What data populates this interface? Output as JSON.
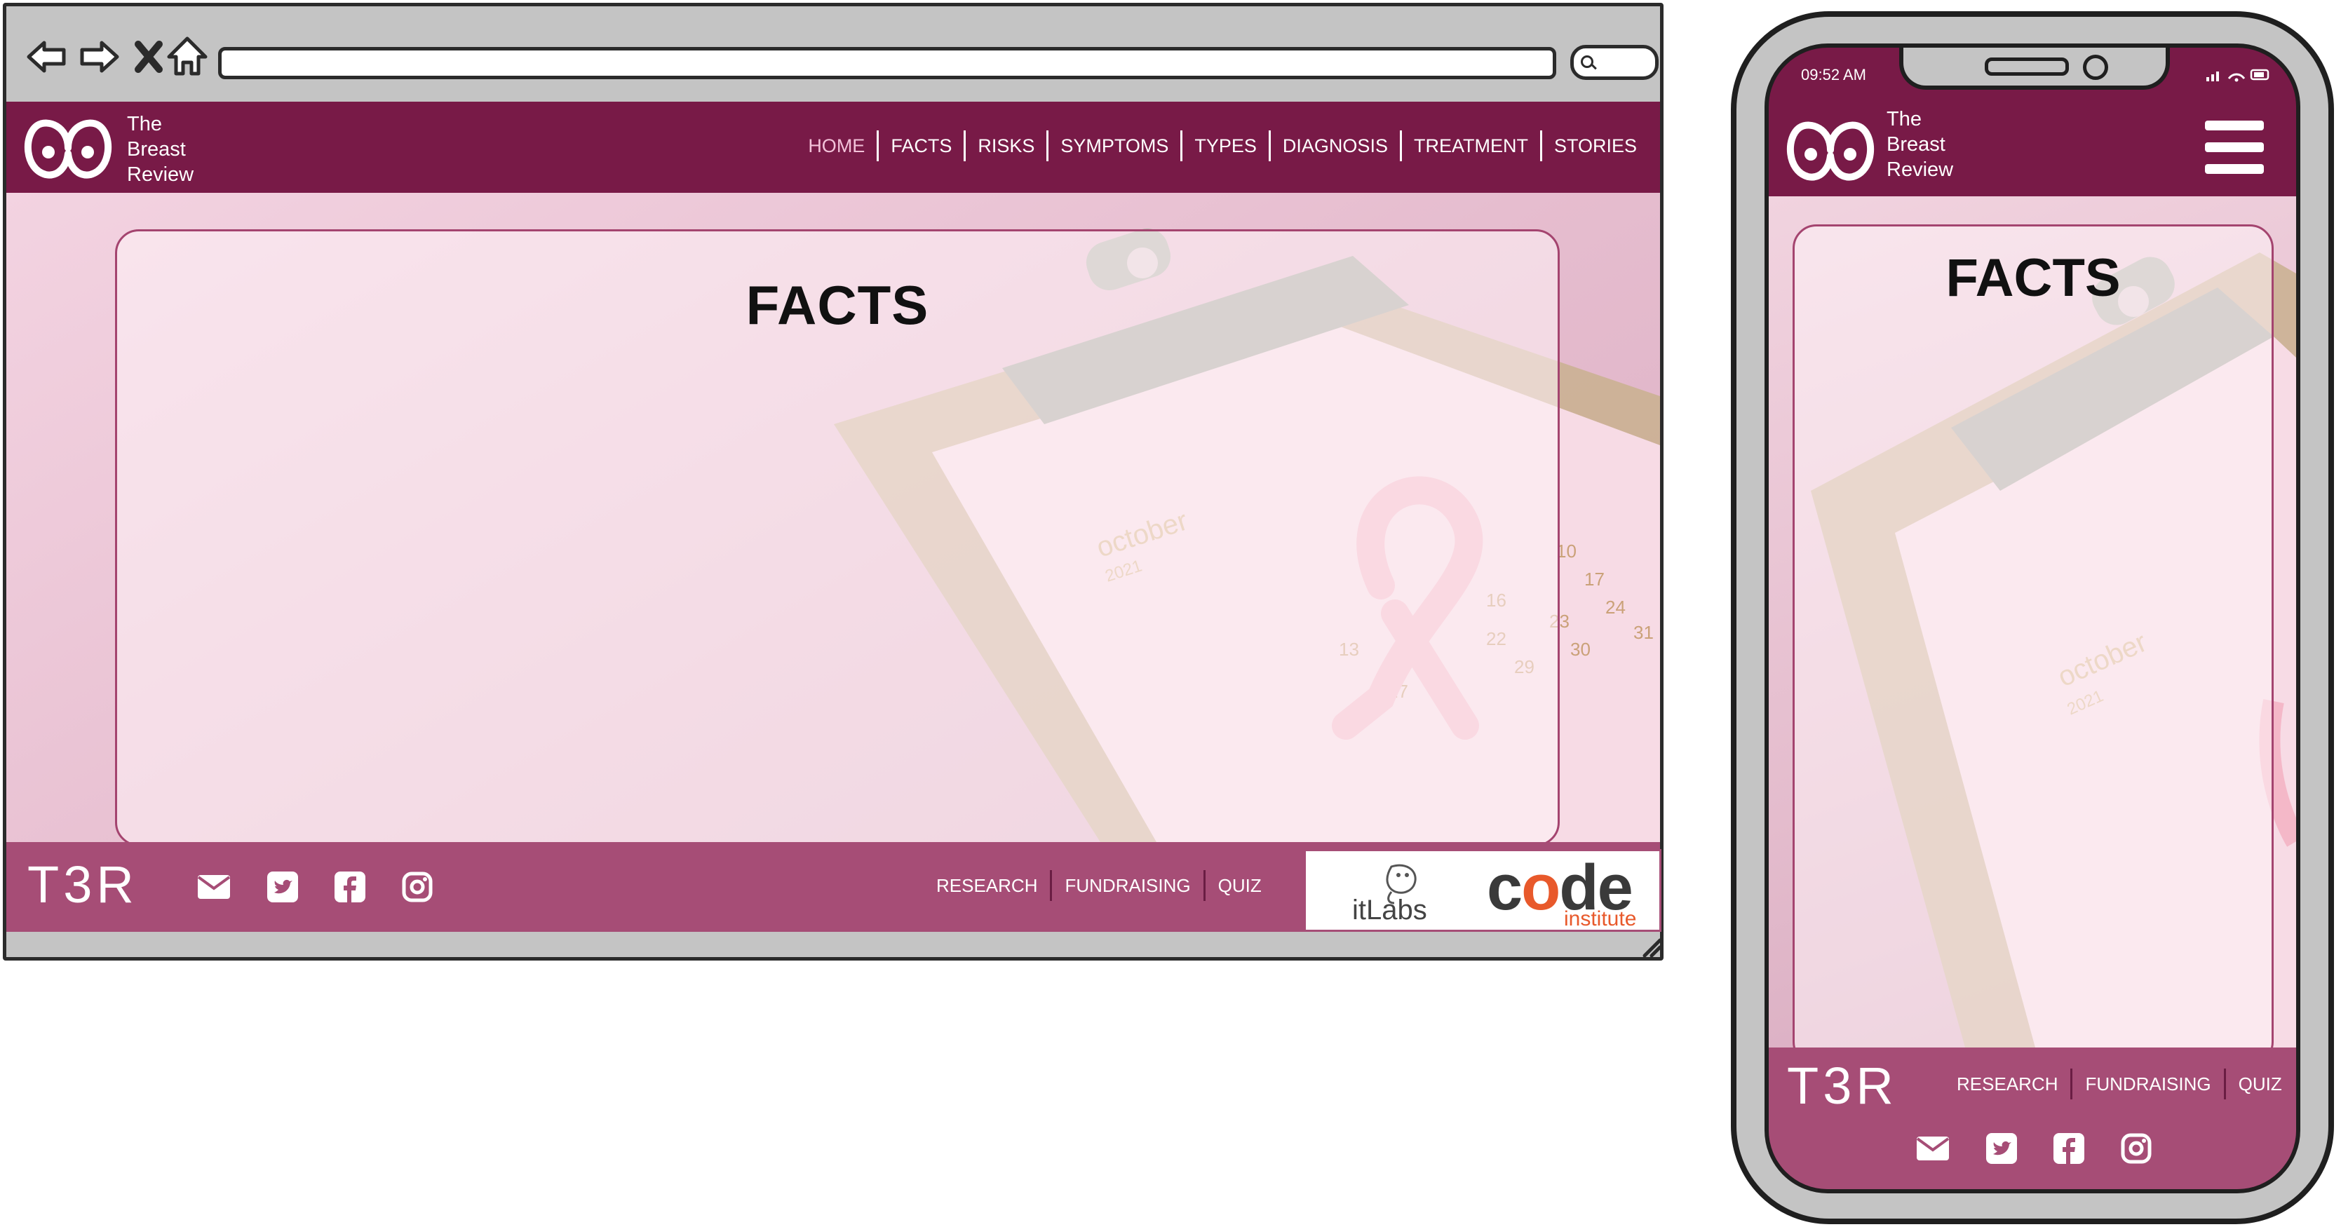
{
  "colors": {
    "header": "#781a47",
    "footer": "#a64d76",
    "chrome": "#c4c4c4",
    "nav_active": "#f2c2d9",
    "code_orange": "#e8592b"
  },
  "browser": {
    "icons": [
      "back-arrow-icon",
      "forward-arrow-icon",
      "close-x-icon",
      "home-icon",
      "search-icon",
      "resize-grip-icon"
    ]
  },
  "brand": {
    "logo_icon": "breast-logo-icon",
    "lines": [
      "The",
      "Breast",
      "Review"
    ]
  },
  "nav": {
    "items": [
      "HOME",
      "FACTS",
      "RISKS",
      "SYMPTOMS",
      "TYPES",
      "DIAGNOSIS",
      "TREATMENT",
      "STORIES"
    ],
    "active": "HOME"
  },
  "hero": {
    "title": "FACTS",
    "calendar": {
      "month": "october",
      "year": "2021",
      "numbers": [
        "10",
        "17",
        "24",
        "31",
        "16",
        "23",
        "30",
        "22",
        "29",
        "13",
        "27"
      ]
    }
  },
  "footer": {
    "logo": "T3R",
    "social_icons": [
      "envelope-icon",
      "twitter-icon",
      "facebook-icon",
      "instagram-icon"
    ],
    "links": [
      "RESEARCH",
      "FUNDRAISING",
      "QUIZ"
    ],
    "partners": {
      "itlabs": "itLabs",
      "code": "code",
      "institute": "institute"
    }
  },
  "mobile": {
    "status_time": "09:52 AM",
    "menu_icon": "hamburger-menu-icon"
  }
}
